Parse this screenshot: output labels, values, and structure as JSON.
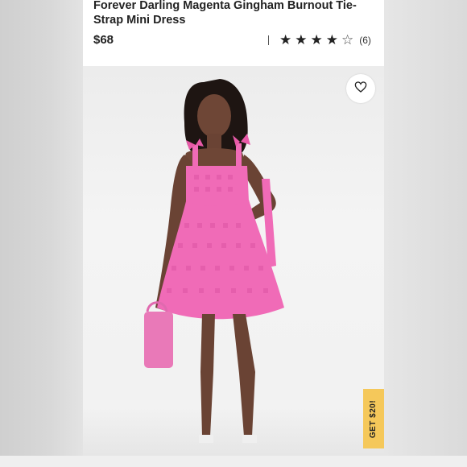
{
  "product": {
    "title": "Forever Darling Magenta Gingham Burnout Tie-Strap Mini Dress",
    "price": "$68",
    "rating": {
      "stars": 4,
      "max": 5,
      "count_label": "(6)"
    }
  },
  "promo": {
    "label": "GET $20!"
  },
  "icons": {
    "favorite": "heart-icon"
  },
  "colors": {
    "dress": "#f06bb7",
    "promo": "#f5c85a",
    "star": "#222222"
  }
}
